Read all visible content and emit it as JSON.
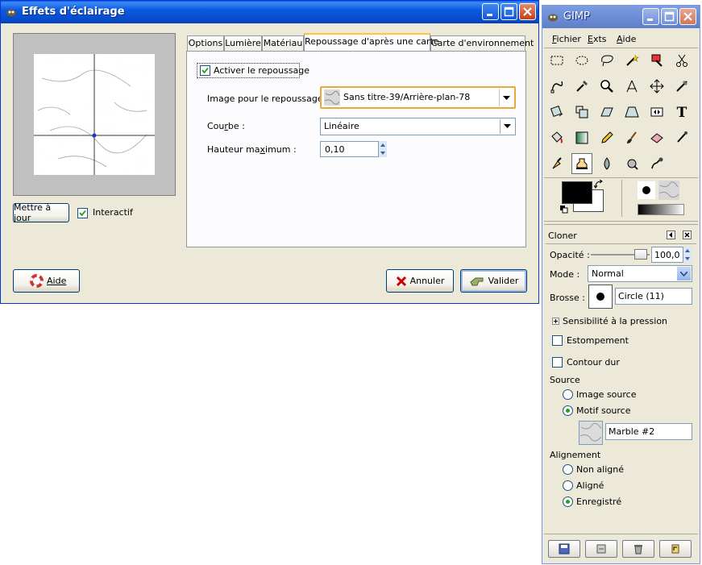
{
  "lighting_dialog": {
    "title": "Effets d'éclairage",
    "tabs": [
      "Options",
      "Lumière",
      "Matériau",
      "Repoussage d'après une carte",
      "Carte d'environnement"
    ],
    "active_tab": "Repoussage d'après une carte",
    "preview": {
      "update_button": "Mettre à jour",
      "interactive_label": "Interactif",
      "interactive_checked": true
    },
    "bump": {
      "enable_label": "Activer le repoussage",
      "enable_checked": true,
      "image_label": "Image pour le repoussage :",
      "image_value": "Sans titre-39/Arrière-plan-78",
      "curve_label": "Courbe :",
      "curve_value": "Linéaire",
      "max_height_label": "Hauteur maximum :",
      "max_height_value": "0,10"
    },
    "buttons": {
      "help": "Aide",
      "cancel": "Annuler",
      "ok": "Valider"
    }
  },
  "gimp_toolbox": {
    "title": "GIMP",
    "menu": [
      "Fichier",
      "Exts",
      "Aide"
    ],
    "tools": [
      "rect-select-icon",
      "ellipse-select-icon",
      "lasso-icon",
      "fuzzy-select-icon",
      "color-select-icon",
      "scissors-icon",
      "paths-icon",
      "color-picker-icon",
      "zoom-icon",
      "measure-icon",
      "move-icon",
      "crop-icon",
      "rotate-icon",
      "scale-icon",
      "shear-icon",
      "perspective-icon",
      "flip-icon",
      "text-icon",
      "bucket-fill-icon",
      "blend-icon",
      "pencil-icon",
      "paintbrush-icon",
      "eraser-icon",
      "airbrush-icon",
      "ink-icon",
      "clone-icon",
      "blur-icon",
      "dodge-burn-icon",
      "smudge-icon"
    ],
    "selected_tool": "clone-icon",
    "fg_color": "#000000",
    "bg_color": "#ffffff",
    "tool_options": {
      "header": "Cloner",
      "opacity_label": "Opacité :",
      "opacity_value": "100,0",
      "mode_label": "Mode :",
      "mode_value": "Normal",
      "brush_label": "Brosse :",
      "brush_value": "Circle (11)",
      "pressure_label": "Sensibilité à la pression",
      "fade_label": "Estompement",
      "fade_checked": false,
      "hard_label": "Contour dur",
      "hard_checked": false,
      "source_header": "Source",
      "source_options": [
        "Image source",
        "Motif source"
      ],
      "source_selected": "Motif source",
      "pattern_value": "Marble #2",
      "alignment_header": "Alignement",
      "alignment_options": [
        "Non aligné",
        "Aligné",
        "Enregistré"
      ],
      "alignment_selected": "Enregistré"
    }
  }
}
